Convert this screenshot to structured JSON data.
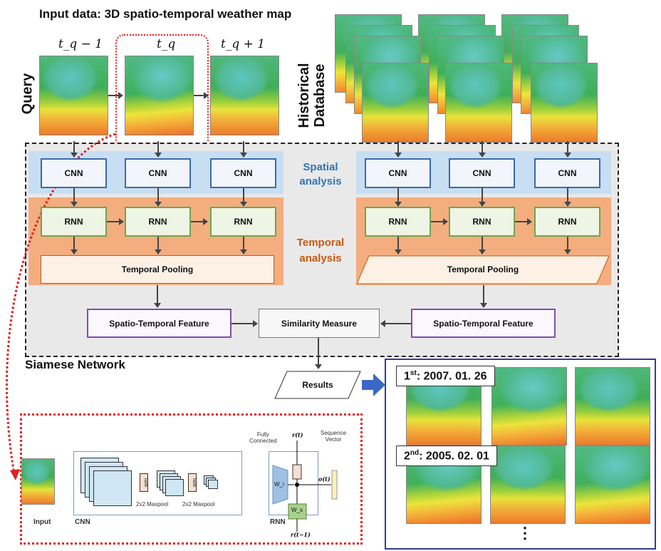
{
  "title": "Input data: 3D spatio-temporal weather map",
  "query": {
    "label": "Query",
    "times": [
      "t_q − 1",
      "t_q",
      "t_q + 1"
    ]
  },
  "database": {
    "label1": "Historical",
    "label2": "Database"
  },
  "spatial": {
    "label1": "Spatial",
    "label2": "analysis",
    "color": "#2e75b6"
  },
  "temporal": {
    "label1": "Temporal",
    "label2": "analysis",
    "color": "#c55a11"
  },
  "cnn": "CNN",
  "rnn": "RNN",
  "pooling": "Temporal Pooling",
  "feature": "Spatio-Temporal Feature",
  "similarity": "Similarity Measure",
  "siamese": "Siamese Network",
  "results": "Results",
  "ranks": [
    {
      "n": "1",
      "sup": "st",
      "date": ": 2007. 01. 26"
    },
    {
      "n": "2",
      "sup": "nd",
      "date": ": 2005. 02. 01"
    }
  ],
  "ellipsis": "⋮",
  "inset": {
    "input": "Input",
    "cnn": "CNN",
    "rnn": "RNN",
    "maxpool": "2x2 Maxpool",
    "tanh": "Tanh",
    "fc1": "Fully",
    "fc2": "Connected",
    "seq1": "Sequence",
    "seq2": "Vector",
    "wi": "W_i",
    "ws": "W_s",
    "rt": "r(t)",
    "rt1": "r(t−1)",
    "ot": "o(t)"
  }
}
